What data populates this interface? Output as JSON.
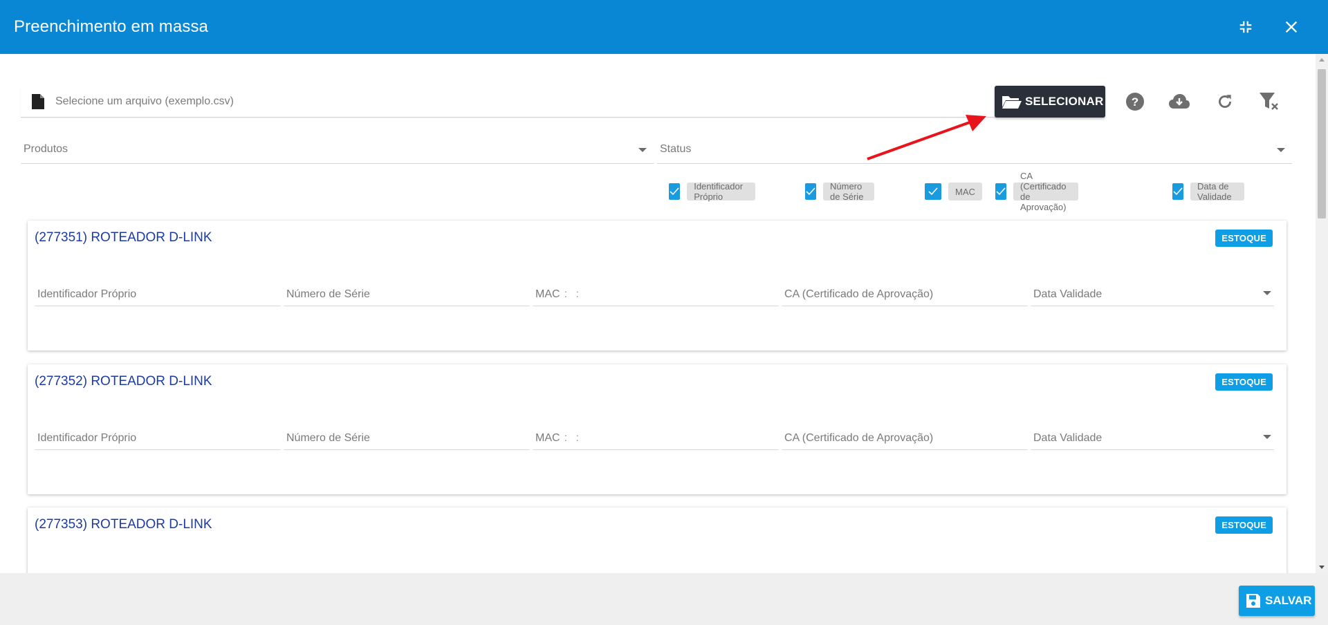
{
  "window": {
    "title": "Preenchimento em massa",
    "icons": {
      "minimize": "compress-icon",
      "close": "close-icon"
    }
  },
  "file_input": {
    "placeholder": "Selecione um arquivo (exemplo.csv)",
    "icon": "file-icon",
    "select_label": "SELECIONAR",
    "select_icon": "folder-open-icon"
  },
  "toolbar": {
    "icons": [
      "help-icon",
      "cloud-download-icon",
      "refresh-icon",
      "filter-clear-icon"
    ]
  },
  "filters": {
    "produtos_label": "Produtos",
    "status_label": "Status"
  },
  "columns": [
    {
      "label": "Identificador Próprio",
      "checked": true
    },
    {
      "label": "Número de Série",
      "checked": true
    },
    {
      "label": "MAC",
      "checked": true
    },
    {
      "label": "CA (Certificado de Aprovação)",
      "checked": true
    },
    {
      "label": "Data de Validade",
      "checked": true
    }
  ],
  "cards": [
    {
      "title": "(277351) ROTEADOR D-LINK",
      "badge": "ESTOQUE",
      "fields": {
        "identificador": "Identificador Próprio",
        "serie": "Número de Série",
        "mac": "MAC",
        "mac_mask": ": :",
        "ca": "CA (Certificado de Aprovação)",
        "validade": "Data Validade"
      }
    },
    {
      "title": "(277352) ROTEADOR D-LINK",
      "badge": "ESTOQUE",
      "fields": {
        "identificador": "Identificador Próprio",
        "serie": "Número de Série",
        "mac": "MAC",
        "mac_mask": ": :",
        "ca": "CA (Certificado de Aprovação)",
        "validade": "Data Validade"
      }
    },
    {
      "title": "(277353) ROTEADOR D-LINK",
      "badge": "ESTOQUE"
    }
  ],
  "footer": {
    "save_label": "SALVAR",
    "save_icon": "floppy-disk-icon"
  },
  "colors": {
    "header": "#0a87d4",
    "accent": "#0d9ee6",
    "dark_button": "#2b2f3a",
    "card_title": "#1c3aa0",
    "annotation_arrow": "#e8141b"
  }
}
